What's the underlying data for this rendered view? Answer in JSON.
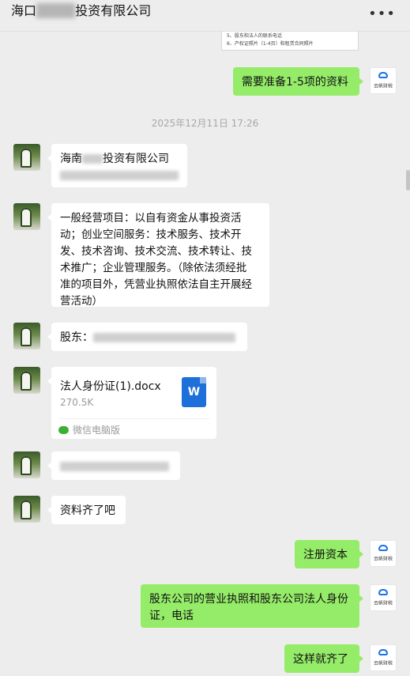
{
  "header": {
    "title_prefix": "海口",
    "title_redacted": "████",
    "title_suffix": "投资有限公司",
    "more_label": "•••"
  },
  "top_document": {
    "line1": "5、股东和法人的联系电话",
    "line2": "6、产权证照片（1-4页）和租赁合同照片"
  },
  "self_logo_text": "云帆财税",
  "messages": {
    "m1": "需要准备1-5项的资料",
    "timestamp": "2025年12月11日 17:26",
    "m2_line1_a": "海南",
    "m2_line1_b": "投资有限公司",
    "m3_line1": "一般经营项目：以自有资金从事投资活",
    "m3_line2": "动；创业空间服务：技术服务、技术开",
    "m3_line3": "发、技术咨询、技术交流、技术转让、技",
    "m3_line4": "术推广；企业管理服务。（除依法须经批",
    "m3_line5": "准的项目外，凭营业执照依法自主开展经",
    "m3_line6": "营活动）",
    "m4": "股东：",
    "file_name": "法人身份证(1).docx",
    "file_size": "270.5K",
    "file_source": "微信电脑版",
    "file_icon_letter": "W",
    "m6": "资料齐了吧",
    "m7": "注册资本",
    "m8_line1": "股东公司的营业执照和股东公司法人身份",
    "m8_line2": "证，电话",
    "m9": "这样就齐了"
  },
  "colors": {
    "background": "#ededed",
    "out_bubble": "#95ec69",
    "in_bubble": "#ffffff",
    "word_blue": "#1e6fd9"
  }
}
